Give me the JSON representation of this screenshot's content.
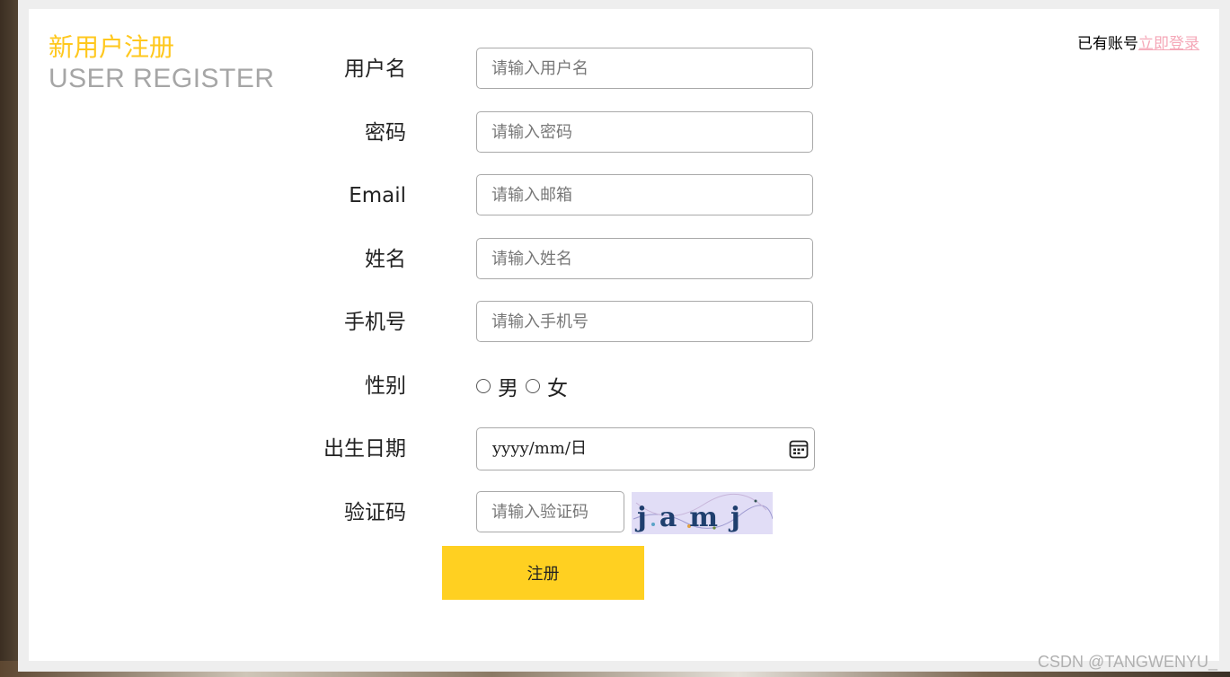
{
  "header": {
    "title_cn": "新用户注册",
    "title_en": "USER REGISTER",
    "login_prefix": "已有账号",
    "login_link": "立即登录"
  },
  "form": {
    "username": {
      "label": "用户名",
      "placeholder": "请输入用户名"
    },
    "password": {
      "label": "密码",
      "placeholder": "请输入密码"
    },
    "email": {
      "label": "Email",
      "placeholder": "请输入邮箱"
    },
    "name": {
      "label": "姓名",
      "placeholder": "请输入姓名"
    },
    "phone": {
      "label": "手机号",
      "placeholder": "请输入手机号"
    },
    "gender": {
      "label": "性别",
      "male": "男",
      "female": "女"
    },
    "birthday": {
      "label": "出生日期",
      "placeholder": "yyyy/mm/日"
    },
    "captcha": {
      "label": "验证码",
      "placeholder": "请输入验证码",
      "image_text": "jamj"
    },
    "submit_label": "注册"
  },
  "watermark": "CSDN @TANGWENYU_",
  "colors": {
    "accent": "#ffd021",
    "title": "#ffc81e",
    "link": "#f5a8b8",
    "captcha_bg": "#e1ddf6"
  }
}
